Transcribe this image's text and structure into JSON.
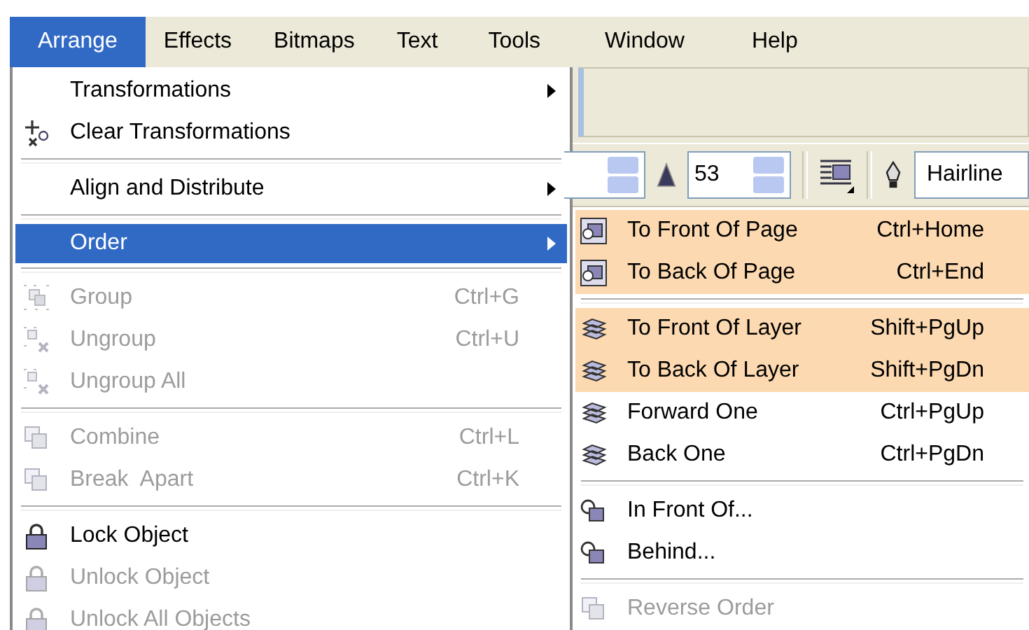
{
  "menubar": [
    {
      "label": "Arrange",
      "selected": true
    },
    {
      "label": "Effects",
      "selected": false
    },
    {
      "label": "Bitmaps",
      "selected": false
    },
    {
      "label": "Text",
      "selected": false
    },
    {
      "label": "Tools",
      "selected": false
    },
    {
      "label": "Window",
      "selected": false
    },
    {
      "label": "Help",
      "selected": false
    }
  ],
  "toolbar": {
    "fields": [
      {
        "value": "53"
      },
      {
        "value": "Hairline"
      }
    ]
  },
  "menu": [
    {
      "kind": "item",
      "label": "Transformations",
      "submenu": true,
      "disabled": false,
      "selected": false
    },
    {
      "kind": "item",
      "label": "Clear Transformations",
      "submenu": false,
      "disabled": false,
      "selected": false
    },
    {
      "kind": "separator"
    },
    {
      "kind": "item",
      "label": "Align and Distribute",
      "submenu": true,
      "disabled": false,
      "selected": false
    },
    {
      "kind": "separator"
    },
    {
      "kind": "item",
      "label": "Order",
      "submenu": true,
      "disabled": false,
      "selected": true
    },
    {
      "kind": "separator"
    },
    {
      "kind": "item",
      "label": "Group",
      "shortcut": "Ctrl+G",
      "submenu": false,
      "disabled": true,
      "selected": false
    },
    {
      "kind": "item",
      "label": "Ungroup",
      "shortcut": "Ctrl+U",
      "submenu": false,
      "disabled": true,
      "selected": false
    },
    {
      "kind": "item",
      "label": "Ungroup All",
      "submenu": false,
      "disabled": true,
      "selected": false
    },
    {
      "kind": "separator"
    },
    {
      "kind": "item",
      "label": "Combine",
      "shortcut": "Ctrl+L",
      "submenu": false,
      "disabled": true,
      "selected": false
    },
    {
      "kind": "item",
      "label": "Break  Apart",
      "shortcut": "Ctrl+K",
      "submenu": false,
      "disabled": true,
      "selected": false
    },
    {
      "kind": "separator"
    },
    {
      "kind": "item",
      "label": "Lock Object",
      "submenu": false,
      "disabled": false,
      "selected": false
    },
    {
      "kind": "item",
      "label": "Unlock Object",
      "submenu": false,
      "disabled": true,
      "selected": false
    },
    {
      "kind": "item",
      "label": "Unlock All Objects",
      "submenu": false,
      "disabled": true,
      "selected": false
    }
  ],
  "submenu": [
    {
      "kind": "item",
      "label": "To Front Of Page",
      "shortcut": "Ctrl+Home",
      "highlighted": true,
      "disabled": false
    },
    {
      "kind": "item",
      "label": "To Back Of Page",
      "shortcut": "Ctrl+End",
      "highlighted": true,
      "disabled": false
    },
    {
      "kind": "separator"
    },
    {
      "kind": "item",
      "label": "To Front Of Layer",
      "shortcut": "Shift+PgUp",
      "highlighted": true,
      "disabled": false
    },
    {
      "kind": "item",
      "label": "To Back Of Layer",
      "shortcut": "Shift+PgDn",
      "highlighted": true,
      "disabled": false
    },
    {
      "kind": "item",
      "label": "Forward One",
      "shortcut": "Ctrl+PgUp",
      "highlighted": false,
      "disabled": false
    },
    {
      "kind": "item",
      "label": "Back One",
      "shortcut": "Ctrl+PgDn",
      "highlighted": false,
      "disabled": false
    },
    {
      "kind": "separator"
    },
    {
      "kind": "item",
      "label": "In Front Of...",
      "highlighted": false,
      "disabled": false
    },
    {
      "kind": "item",
      "label": "Behind...",
      "highlighted": false,
      "disabled": false
    },
    {
      "kind": "separator"
    },
    {
      "kind": "item",
      "label": "Reverse Order",
      "highlighted": false,
      "disabled": true
    }
  ]
}
